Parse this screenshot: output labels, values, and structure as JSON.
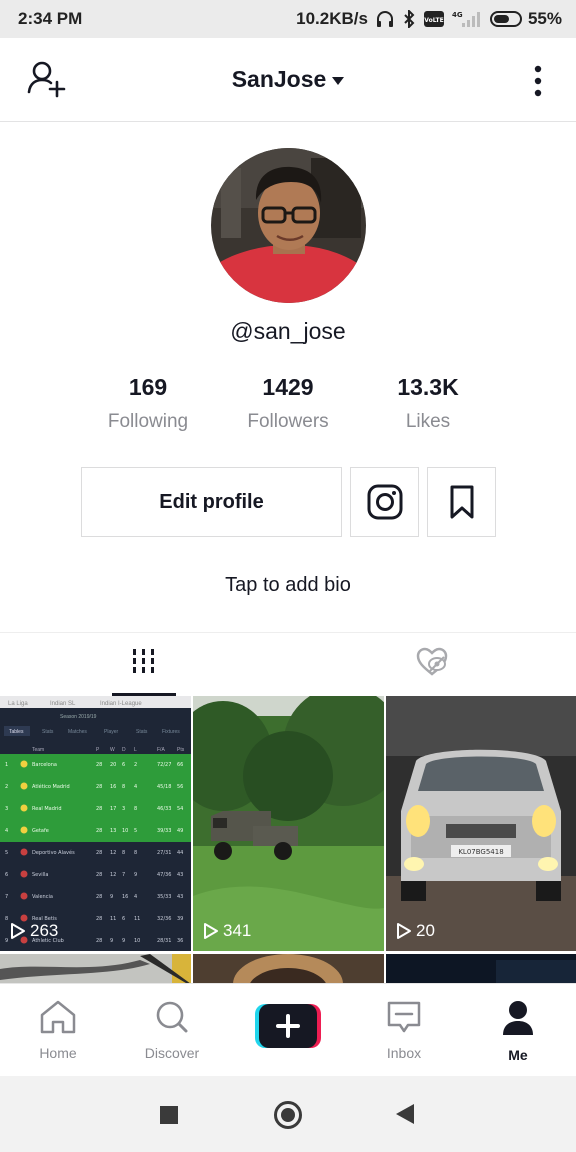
{
  "status_bar": {
    "time": "2:34 PM",
    "network_speed": "10.2KB/s",
    "icons": [
      "headphones-icon",
      "bluetooth-icon",
      "volte-icon",
      "signal-4g-icon",
      "battery-icon"
    ],
    "signal_label": "4G",
    "volte_label": "VoLTE",
    "battery_level": 0.55,
    "battery_text": "55%"
  },
  "header": {
    "title": "SanJose",
    "left_icon": "add-user-icon",
    "right_icon": "more-vertical-icon"
  },
  "profile": {
    "username": "@san_jose",
    "stats": [
      {
        "value": "169",
        "label": "Following"
      },
      {
        "value": "1429",
        "label": "Followers"
      },
      {
        "value": "13.3K",
        "label": "Likes"
      }
    ],
    "edit_profile_label": "Edit profile",
    "bio": "Tap to add bio"
  },
  "tabs": [
    {
      "icon": "grid-videos-icon",
      "active": true
    },
    {
      "icon": "liked-heart-icon",
      "active": false
    }
  ],
  "videos": [
    {
      "views": "263"
    },
    {
      "views": "341"
    },
    {
      "views": "20"
    }
  ],
  "thumb1_text": {
    "tabs": [
      "La Liga",
      "Indian SL",
      "Indian I-League"
    ],
    "season": "Season 2019/19",
    "subtabs": [
      "Tables",
      "Stats",
      "Matches",
      "Player",
      "Stats",
      "Fixtures"
    ],
    "headers": [
      "Team",
      "P",
      "W",
      "D",
      "L",
      "F/A",
      "Pts"
    ],
    "rows": [
      {
        "pos": "1",
        "team": "Barcelona",
        "p": "28",
        "w": "20",
        "d": "6",
        "l": "2",
        "fa": "72/27",
        "pts": "66"
      },
      {
        "pos": "2",
        "team": "Atlético Madrid",
        "p": "28",
        "w": "16",
        "d": "8",
        "l": "4",
        "fa": "45/18",
        "pts": "56"
      },
      {
        "pos": "3",
        "team": "Real Madrid",
        "p": "28",
        "w": "17",
        "d": "3",
        "l": "8",
        "fa": "46/33",
        "pts": "54"
      },
      {
        "pos": "4",
        "team": "Getafe",
        "p": "28",
        "w": "13",
        "d": "10",
        "l": "5",
        "fa": "39/33",
        "pts": "49"
      },
      {
        "pos": "5",
        "team": "Deportivo Alavés",
        "p": "28",
        "w": "12",
        "d": "8",
        "l": "8",
        "fa": "27/31",
        "pts": "44"
      },
      {
        "pos": "6",
        "team": "Sevilla",
        "p": "28",
        "w": "12",
        "d": "7",
        "l": "9",
        "fa": "47/36",
        "pts": "43"
      },
      {
        "pos": "7",
        "team": "Valencia",
        "p": "28",
        "w": "9",
        "d": "16",
        "l": "4",
        "fa": "35/33",
        "pts": "43"
      },
      {
        "pos": "8",
        "team": "Real Betis",
        "p": "28",
        "w": "11",
        "d": "6",
        "l": "11",
        "fa": "32/36",
        "pts": "39"
      },
      {
        "pos": "9",
        "team": "Athletic Club",
        "p": "28",
        "w": "9",
        "d": "9",
        "l": "10",
        "fa": "28/31",
        "pts": "36"
      }
    ]
  },
  "car_plate": "KL07BG5418",
  "bottom_nav": [
    {
      "label": "Home",
      "icon": "home-icon"
    },
    {
      "label": "Discover",
      "icon": "search-icon"
    },
    {
      "label": "",
      "icon": "create-plus-icon"
    },
    {
      "label": "Inbox",
      "icon": "inbox-icon"
    },
    {
      "label": "Me",
      "icon": "profile-icon"
    }
  ],
  "android_nav": [
    "recents-icon",
    "home-circle-icon",
    "back-icon"
  ],
  "colors": {
    "text": "#161823",
    "muted": "#8a8b91",
    "border": "#dcdcdd",
    "accent_cyan": "#20d5ec",
    "accent_red": "#ee1d52"
  }
}
